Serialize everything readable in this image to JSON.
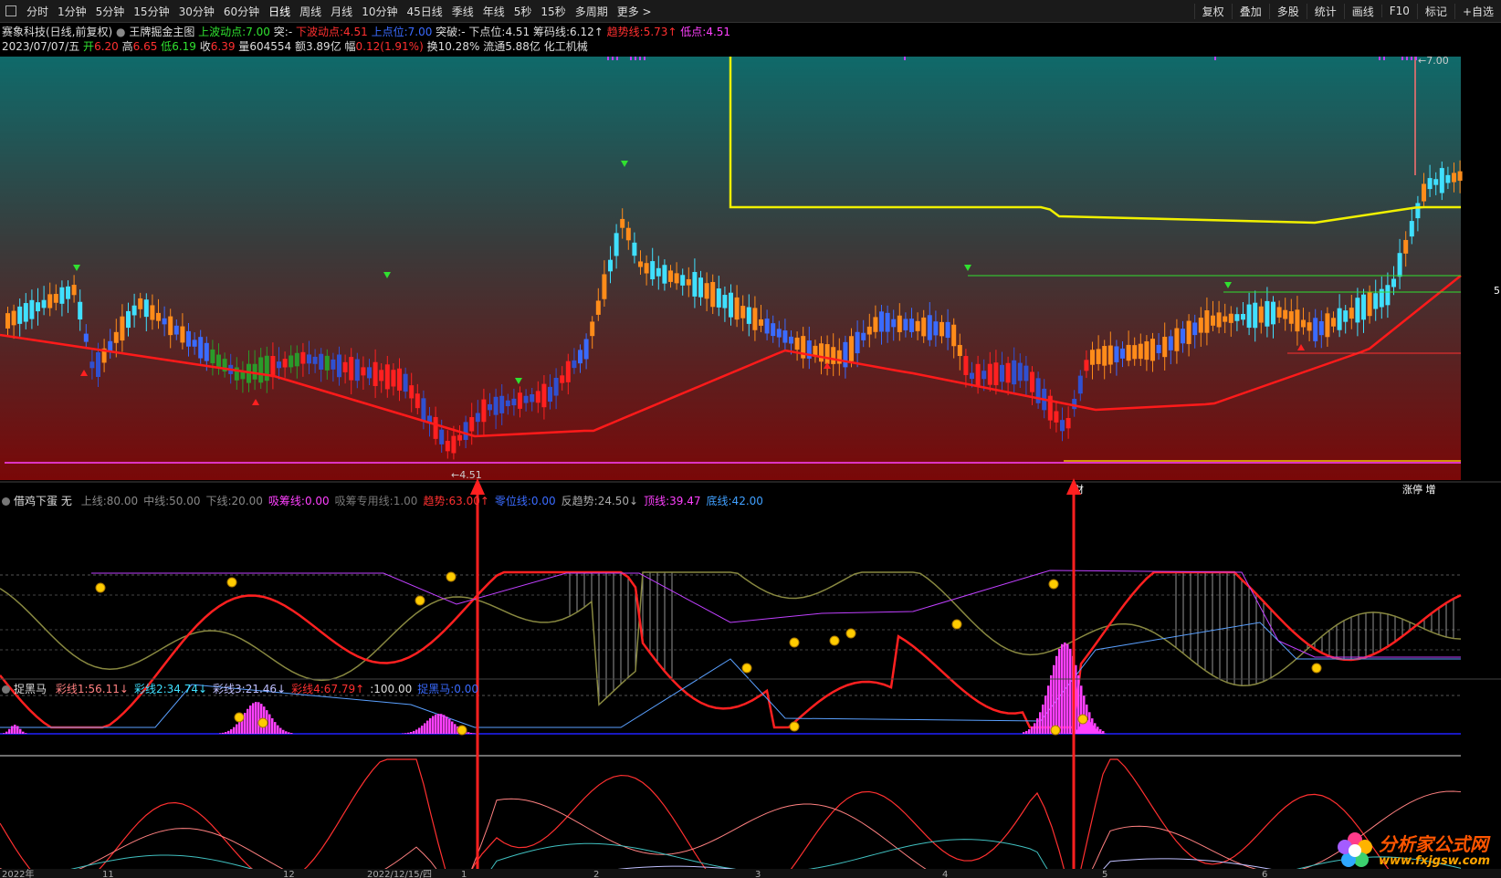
{
  "toolbar": {
    "periods": [
      "分时",
      "1分钟",
      "5分钟",
      "15分钟",
      "30分钟",
      "60分钟",
      "日线",
      "周线",
      "月线",
      "10分钟",
      "45日线",
      "季线",
      "年线",
      "5秒",
      "15秒",
      "多周期",
      "更多 >"
    ],
    "active_period": "日线",
    "right_buttons": [
      "复权",
      "叠加",
      "多股",
      "统计",
      "画线",
      "F10",
      "标记",
      "+自选"
    ]
  },
  "header": {
    "stock": "赛象科技(日线,前复权)",
    "indicator_name": "王牌掘金主图",
    "upper_wave_label": "上波动点:",
    "upper_wave_value": "7.00",
    "break_label": "突:",
    "break_value": "-",
    "lower_wave_label": "下波动点:",
    "lower_wave_value": "4.51",
    "up_point_label": "上点位:",
    "up_point_value": "7.00",
    "breakout_label": "突破:",
    "breakout_value": "-",
    "down_point_label": "下点位:",
    "down_point_value": "4.51",
    "chip_label": "筹码线:",
    "chip_value": "6.12↑",
    "trend_label": "趋势线:",
    "trend_value": "5.73↑",
    "low_label": "低点:",
    "low_value": "4.51",
    "date": "2023/07/07/五",
    "open_label": "开",
    "open": "6.20",
    "high_label": "高",
    "high": "6.65",
    "low2_label": "低",
    "low2": "6.19",
    "close_label": "收",
    "close": "6.39",
    "vol_label": "量",
    "vol": "604554",
    "amount_label": "额",
    "amount": "3.89亿",
    "range_label": "幅",
    "range": "0.12(1.91%)",
    "turnover_label": "换",
    "turnover": "10.28%",
    "float_label": "流通",
    "float": "5.88亿",
    "sector": "化工机械"
  },
  "main_chart": {
    "labels": {
      "high_mark": "←7.00",
      "low_mark": "←4.51",
      "cai": "财",
      "right_tag": "涨停 增",
      "right_edge": "5"
    }
  },
  "panel2": {
    "name": "借鸡下蛋",
    "mode": "无",
    "items": [
      {
        "label": "上线:",
        "value": "80.00",
        "color": "#888"
      },
      {
        "label": "中线:",
        "value": "50.00",
        "color": "#888"
      },
      {
        "label": "下线:",
        "value": "20.00",
        "color": "#888"
      },
      {
        "label": "吸筹线:",
        "value": "0.00",
        "color": "#ff40ff"
      },
      {
        "label": "吸筹专用线:",
        "value": "1.00",
        "color": "#777"
      },
      {
        "label": "趋势:",
        "value": "63.00↑",
        "color": "#ff3030"
      },
      {
        "label": "零位线:",
        "value": "0.00",
        "color": "#3a6bff"
      },
      {
        "label": "反趋势:",
        "value": "24.50↓",
        "color": "#aaa"
      },
      {
        "label": "顶线:",
        "value": "39.47",
        "color": "#ff40ff"
      },
      {
        "label": "底线:",
        "value": "42.00",
        "color": "#40a0ff"
      }
    ]
  },
  "panel3": {
    "name": "捉黑马",
    "items": [
      {
        "label": "彩线1:",
        "value": "56.11↓",
        "color": "#ff8080"
      },
      {
        "label": "彩线2:",
        "value": "34.74↓",
        "color": "#40e0ff"
      },
      {
        "label": "彩线3:",
        "value": "21.46↓",
        "color": "#c0c0ff"
      },
      {
        "label": "彩线4:",
        "value": "67.79↑",
        "color": "#ff3030"
      },
      {
        "label": "",
        "value": ":100.00",
        "color": "#ddd"
      },
      {
        "label": "捉黑马:",
        "value": "0.00",
        "color": "#3a6bff"
      }
    ]
  },
  "xaxis": {
    "labels": [
      "2022年",
      "11",
      "12",
      "2022/12/15/四",
      "1",
      "2",
      "3",
      "4",
      "5",
      "6"
    ]
  },
  "logo": {
    "cn": "分析家公式网",
    "url": "www.fxjgsw.com"
  }
}
